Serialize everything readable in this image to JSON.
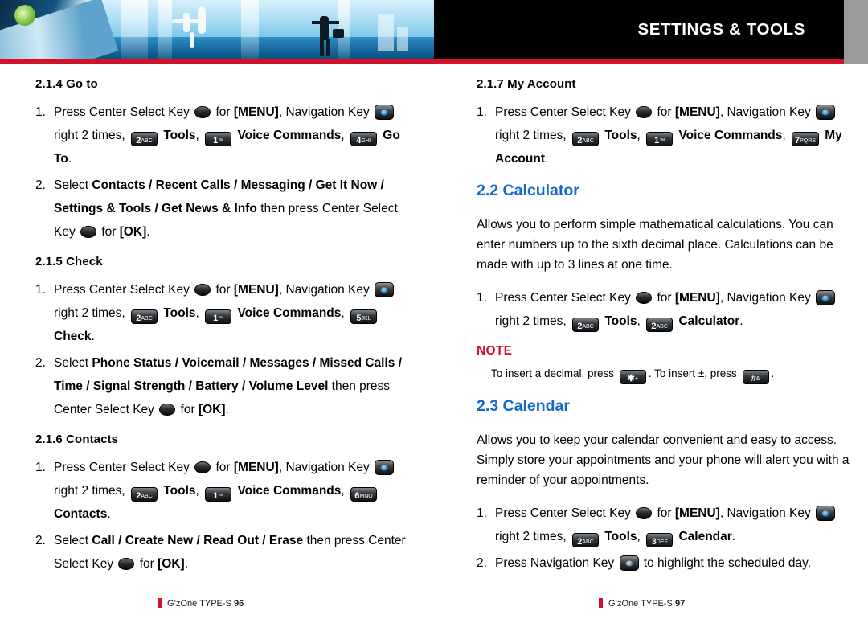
{
  "header": {
    "title": "SETTINGS & TOOLS"
  },
  "keys": {
    "center": "center-select-key",
    "nav": "navigation-key",
    "nav_blue": "navigation-key-blue",
    "k1": "1 ™",
    "k2": "2 ABC",
    "k3": "3 DEF",
    "k4": "4 GHI",
    "k5": "5 JKL",
    "k6": "6 MNO",
    "k7": "7 PQRS",
    "star": "* + ",
    "pound": "# &"
  },
  "left": {
    "sections": [
      {
        "id": "2-1-4",
        "heading": "2.1.4 Go to",
        "steps": [
          {
            "num": "1.",
            "parts": [
              {
                "t": "text",
                "v": "Press Center Select Key "
              },
              {
                "t": "key",
                "k": "center"
              },
              {
                "t": "text",
                "v": " for "
              },
              {
                "t": "bold",
                "v": "[MENU]"
              },
              {
                "t": "text",
                "v": ", Navigation Key "
              },
              {
                "t": "key",
                "k": "nav_blue"
              },
              {
                "t": "text",
                "v": " right 2 times, "
              },
              {
                "t": "key",
                "k": "k2"
              },
              {
                "t": "bold",
                "v": " Tools"
              },
              {
                "t": "text",
                "v": ", "
              },
              {
                "t": "key",
                "k": "k1"
              },
              {
                "t": "bold",
                "v": " Voice Commands"
              },
              {
                "t": "text",
                "v": ", "
              },
              {
                "t": "key",
                "k": "k4"
              },
              {
                "t": "bold",
                "v": " Go To"
              },
              {
                "t": "text",
                "v": "."
              }
            ]
          },
          {
            "num": "2.",
            "parts": [
              {
                "t": "text",
                "v": "Select "
              },
              {
                "t": "bold",
                "v": "Contacts / Recent Calls / Messaging / Get It Now / Settings & Tools / Get News & Info"
              },
              {
                "t": "text",
                "v": " then press Center Select Key "
              },
              {
                "t": "key",
                "k": "center"
              },
              {
                "t": "text",
                "v": " for "
              },
              {
                "t": "bold",
                "v": "[OK]"
              },
              {
                "t": "text",
                "v": "."
              }
            ]
          }
        ]
      },
      {
        "id": "2-1-5",
        "heading": "2.1.5 Check",
        "steps": [
          {
            "num": "1.",
            "parts": [
              {
                "t": "text",
                "v": "Press Center Select Key "
              },
              {
                "t": "key",
                "k": "center"
              },
              {
                "t": "text",
                "v": " for "
              },
              {
                "t": "bold",
                "v": "[MENU]"
              },
              {
                "t": "text",
                "v": ", Navigation Key "
              },
              {
                "t": "key",
                "k": "nav_blue"
              },
              {
                "t": "text",
                "v": " right 2 times, "
              },
              {
                "t": "key",
                "k": "k2"
              },
              {
                "t": "bold",
                "v": " Tools"
              },
              {
                "t": "text",
                "v": ", "
              },
              {
                "t": "key",
                "k": "k1"
              },
              {
                "t": "bold",
                "v": " Voice Commands"
              },
              {
                "t": "text",
                "v": ", "
              },
              {
                "t": "key",
                "k": "k5"
              },
              {
                "t": "bold",
                "v": " Check"
              },
              {
                "t": "text",
                "v": "."
              }
            ]
          },
          {
            "num": "2.",
            "parts": [
              {
                "t": "text",
                "v": "Select "
              },
              {
                "t": "bold",
                "v": "Phone Status / Voicemail / Messages / Missed Calls / Time / Signal Strength / Battery / Volume Level"
              },
              {
                "t": "text",
                "v": " then press Center Select Key "
              },
              {
                "t": "key",
                "k": "center"
              },
              {
                "t": "text",
                "v": " for "
              },
              {
                "t": "bold",
                "v": "[OK]"
              },
              {
                "t": "text",
                "v": "."
              }
            ]
          }
        ]
      },
      {
        "id": "2-1-6",
        "heading": "2.1.6 Contacts",
        "steps": [
          {
            "num": "1.",
            "parts": [
              {
                "t": "text",
                "v": "Press Center Select Key "
              },
              {
                "t": "key",
                "k": "center"
              },
              {
                "t": "text",
                "v": " for "
              },
              {
                "t": "bold",
                "v": "[MENU]"
              },
              {
                "t": "text",
                "v": ", Navigation Key "
              },
              {
                "t": "key",
                "k": "nav_blue"
              },
              {
                "t": "text",
                "v": " right 2 times, "
              },
              {
                "t": "key",
                "k": "k2"
              },
              {
                "t": "bold",
                "v": " Tools"
              },
              {
                "t": "text",
                "v": ", "
              },
              {
                "t": "key",
                "k": "k1"
              },
              {
                "t": "bold",
                "v": " Voice Commands"
              },
              {
                "t": "text",
                "v": ", "
              },
              {
                "t": "key",
                "k": "k6"
              },
              {
                "t": "bold",
                "v": " Contacts"
              },
              {
                "t": "text",
                "v": "."
              }
            ]
          },
          {
            "num": "2.",
            "parts": [
              {
                "t": "text",
                "v": "Select "
              },
              {
                "t": "bold",
                "v": "Call / Create New / Read Out / Erase"
              },
              {
                "t": "text",
                "v": " then press Center Select Key "
              },
              {
                "t": "key",
                "k": "center"
              },
              {
                "t": "text",
                "v": " for "
              },
              {
                "t": "bold",
                "v": "[OK]"
              },
              {
                "t": "text",
                "v": "."
              }
            ]
          }
        ]
      }
    ],
    "footer": {
      "brand": "G’zOne TYPE-S",
      "page": "96"
    }
  },
  "right": {
    "section_my_account": {
      "heading": "2.1.7 My Account",
      "steps": [
        {
          "num": "1.",
          "parts": [
            {
              "t": "text",
              "v": "Press Center Select Key "
            },
            {
              "t": "key",
              "k": "center"
            },
            {
              "t": "text",
              "v": " for "
            },
            {
              "t": "bold",
              "v": "[MENU]"
            },
            {
              "t": "text",
              "v": ", Navigation Key "
            },
            {
              "t": "key",
              "k": "nav_blue"
            },
            {
              "t": "text",
              "v": " right 2 times, "
            },
            {
              "t": "key",
              "k": "k2"
            },
            {
              "t": "bold",
              "v": " Tools"
            },
            {
              "t": "text",
              "v": ", "
            },
            {
              "t": "key",
              "k": "k1"
            },
            {
              "t": "bold",
              "v": " Voice Commands"
            },
            {
              "t": "text",
              "v": ", "
            },
            {
              "t": "key",
              "k": "k7"
            },
            {
              "t": "bold",
              "v": " My Account"
            },
            {
              "t": "text",
              "v": "."
            }
          ]
        }
      ]
    },
    "section_calculator": {
      "heading": "2.2 Calculator",
      "body": "Allows you to perform simple mathematical calculations. You can enter numbers up to the sixth decimal place. Calculations can be made with up to 3 lines at one time.",
      "steps": [
        {
          "num": "1.",
          "parts": [
            {
              "t": "text",
              "v": "Press Center Select Key "
            },
            {
              "t": "key",
              "k": "center"
            },
            {
              "t": "text",
              "v": " for "
            },
            {
              "t": "bold",
              "v": "[MENU]"
            },
            {
              "t": "text",
              "v": ", Navigation Key "
            },
            {
              "t": "key",
              "k": "nav_blue"
            },
            {
              "t": "text",
              "v": " right 2 times, "
            },
            {
              "t": "key",
              "k": "k2"
            },
            {
              "t": "bold",
              "v": " Tools"
            },
            {
              "t": "text",
              "v": ", "
            },
            {
              "t": "key",
              "k": "k2"
            },
            {
              "t": "bold",
              "v": " Calculator"
            },
            {
              "t": "text",
              "v": "."
            }
          ]
        }
      ],
      "note_heading": "NOTE",
      "note_parts": [
        {
          "t": "text",
          "v": "To insert a decimal, press "
        },
        {
          "t": "key",
          "k": "star"
        },
        {
          "t": "text",
          "v": ". To insert ±, press "
        },
        {
          "t": "key",
          "k": "pound"
        },
        {
          "t": "text",
          "v": "."
        }
      ]
    },
    "section_calendar": {
      "heading": "2.3 Calendar",
      "body": "Allows you to keep your calendar convenient and easy to access. Simply store your appointments and your phone will alert you with a reminder of your appointments.",
      "steps": [
        {
          "num": "1.",
          "parts": [
            {
              "t": "text",
              "v": "Press Center Select Key "
            },
            {
              "t": "key",
              "k": "center"
            },
            {
              "t": "text",
              "v": " for "
            },
            {
              "t": "bold",
              "v": "[MENU]"
            },
            {
              "t": "text",
              "v": ", Navigation Key "
            },
            {
              "t": "key",
              "k": "nav_blue"
            },
            {
              "t": "text",
              "v": " right 2 times, "
            },
            {
              "t": "key",
              "k": "k2"
            },
            {
              "t": "bold",
              "v": " Tools"
            },
            {
              "t": "text",
              "v": ", "
            },
            {
              "t": "key",
              "k": "k3"
            },
            {
              "t": "bold",
              "v": " Calendar"
            },
            {
              "t": "text",
              "v": "."
            }
          ]
        },
        {
          "num": "2.",
          "parts": [
            {
              "t": "text",
              "v": "Press Navigation Key "
            },
            {
              "t": "key",
              "k": "nav"
            },
            {
              "t": "text",
              "v": " to highlight the scheduled day."
            }
          ]
        }
      ]
    },
    "footer": {
      "brand": "G’zOne TYPE-S",
      "page": "97"
    }
  },
  "colors": {
    "accent_blue": "#1569c7",
    "accent_red": "#d2112b",
    "header_bg": "#000000"
  }
}
